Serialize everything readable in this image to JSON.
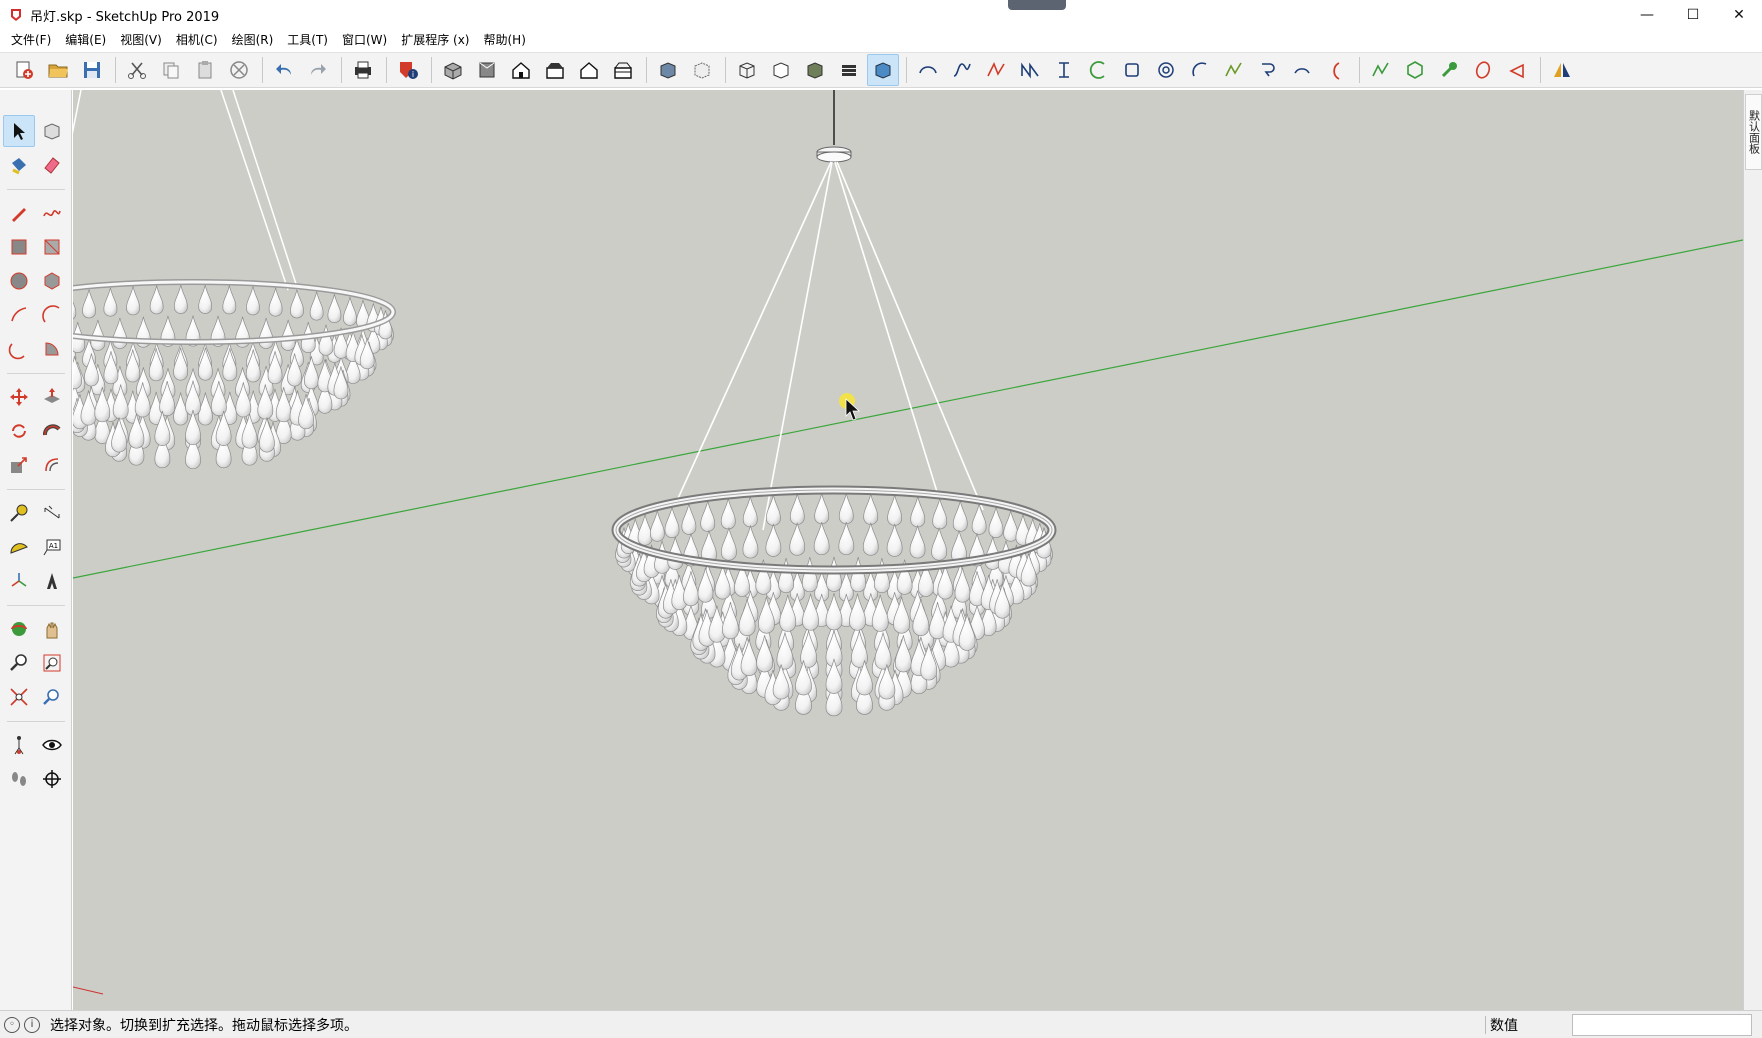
{
  "window": {
    "title": "吊灯.skp - SketchUp Pro 2019",
    "minimize": "—",
    "maximize": "☐",
    "close": "✕"
  },
  "menu": [
    "文件(F)",
    "编辑(E)",
    "视图(V)",
    "相机(C)",
    "绘图(R)",
    "工具(T)",
    "窗口(W)",
    "扩展程序 (x)",
    "帮助(H)"
  ],
  "toolbar_icons": [
    "new-file-icon",
    "open-folder-icon",
    "save-icon",
    "sep",
    "cut-icon",
    "copy-icon",
    "paste-icon",
    "erase-icon",
    "sep",
    "undo-icon",
    "redo-icon",
    "sep",
    "print-icon",
    "sep",
    "model-info-icon",
    "sep",
    "iso-view-icon",
    "top-view-icon",
    "front-view-icon",
    "right-view-icon",
    "back-view-icon",
    "left-view-icon",
    "sep",
    "xray-icon",
    "back-edges-icon",
    "sep",
    "wireframe-icon",
    "hidden-line-icon",
    "shaded-icon",
    "shaded-textures-icon",
    "monochrome-icon",
    "sep",
    "curve-tool-1-icon",
    "curve-tool-2-icon",
    "curve-tool-3-icon",
    "curve-tool-4-icon",
    "curve-tool-5-icon",
    "curve-tool-6-icon",
    "rectangle-tool-icon",
    "spiral-tool-icon",
    "arc-tool-a-icon",
    "zigzag-tool-icon",
    "hook-tool-icon",
    "arc-tool-b-icon",
    "arc-tool-c-icon",
    "sep",
    "polyline-tool-icon",
    "polygon-tool-icon",
    "wrench-tool-icon",
    "ellipse-tool-icon",
    "flip-tool-icon",
    "sep",
    "mirror-tool-icon"
  ],
  "active_toolbar_icon": "monochrome-icon",
  "left_tools": [
    [
      "select-icon",
      "component-icon"
    ],
    [
      "paint-bucket-icon",
      "eraser-icon"
    ],
    "gap",
    [
      "pencil-line-icon",
      "freehand-icon"
    ],
    [
      "rectangle-icon",
      "rotated-rectangle-icon"
    ],
    [
      "circle-icon",
      "polygon-icon"
    ],
    [
      "arc-icon",
      "two-point-arc-icon"
    ],
    [
      "three-point-arc-icon",
      "pie-icon"
    ],
    "gap",
    [
      "move-icon",
      "push-pull-icon"
    ],
    [
      "rotate-icon",
      "follow-me-icon"
    ],
    [
      "scale-icon",
      "offset-icon"
    ],
    "gap",
    [
      "tape-measure-icon",
      "dimension-icon"
    ],
    [
      "protractor-icon",
      "text-icon"
    ],
    [
      "axes-icon",
      "3d-text-icon"
    ],
    "gap",
    [
      "orbit-icon",
      "pan-icon"
    ],
    [
      "zoom-icon",
      "zoom-window-icon"
    ],
    [
      "zoom-extents-icon",
      "previous-view-icon"
    ],
    "gap",
    [
      "position-camera-icon",
      "look-around-icon"
    ],
    [
      "walk-icon",
      "section-plane-icon"
    ]
  ],
  "active_left_tool": "select-icon",
  "tray_label": "默认面板",
  "status": {
    "hint": "选择对象。切换到扩充选择。拖动鼠标选择多项。",
    "measurements_label": "数值",
    "measurements_value": ""
  },
  "colors": {
    "viewport_bg": "#cdcdc8",
    "green_axis": "#3aa63a",
    "red_axis": "#d03030",
    "chandelier": "#ffffff",
    "chandelier_edge": "#8c8c8c"
  }
}
